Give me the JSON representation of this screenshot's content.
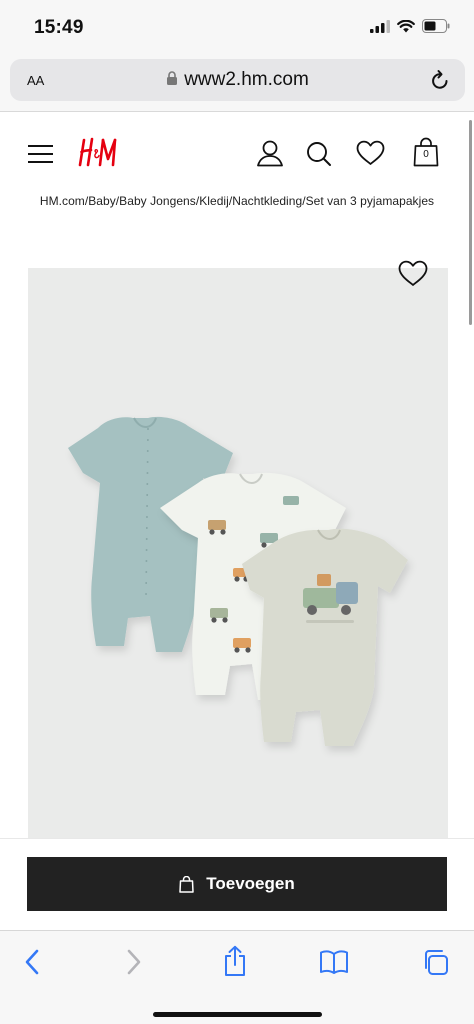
{
  "status_bar": {
    "time": "15:49"
  },
  "safari": {
    "text_size_label": "AA",
    "url": "www2.hm.com"
  },
  "header": {
    "logo_text": "H&M",
    "bag_count": "0"
  },
  "breadcrumb": "HM.com/Baby/Baby Jongens/Kledij/Nachtkleding/Set van 3 pyjamapakjes",
  "product": {
    "add_label": "Toevoegen"
  },
  "colors": {
    "button_background": "#222222",
    "logo_red": "#e50010",
    "safari_blue": "#3478f6"
  },
  "icons": [
    "signal-icon",
    "wifi-icon",
    "battery-icon",
    "lock-icon",
    "reload-icon",
    "menu-icon",
    "account-icon",
    "search-icon",
    "heart-icon",
    "bag-icon",
    "back-icon",
    "forward-icon",
    "share-icon",
    "bookmarks-icon",
    "tabs-icon"
  ]
}
